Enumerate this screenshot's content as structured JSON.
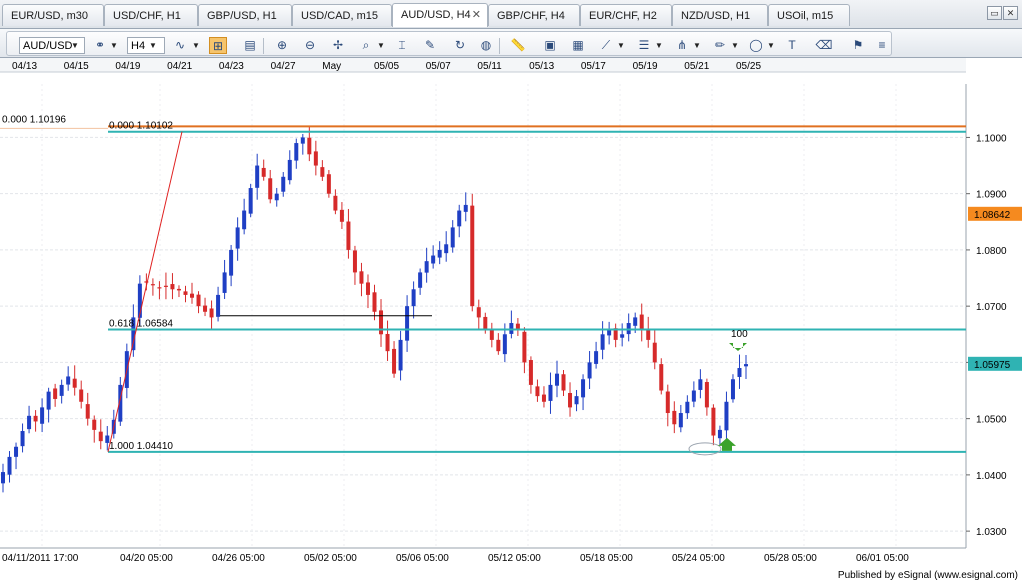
{
  "tabs": [
    {
      "label": "EUR/USD, m30",
      "active": false
    },
    {
      "label": "USD/CHF, H1",
      "active": false
    },
    {
      "label": "GBP/USD, H1",
      "active": false
    },
    {
      "label": "USD/CAD, m15",
      "active": false
    },
    {
      "label": "AUD/USD, H4",
      "active": true
    },
    {
      "label": "GBP/CHF, H4",
      "active": false
    },
    {
      "label": "EUR/CHF, H2",
      "active": false
    },
    {
      "label": "NZD/USD, H1",
      "active": false
    },
    {
      "label": "USOil, m15",
      "active": false
    }
  ],
  "tab_close_glyph": "✕",
  "toolbar": {
    "symbol": "AUD/USD",
    "interval": "H4"
  },
  "chart_data": {
    "type": "candlestick",
    "symbol": "AUD/USD",
    "interval": "H4",
    "ylim": [
      1.027,
      1.1095
    ],
    "y_ticks": [
      "1.1000",
      "1.0900",
      "1.0800",
      "1.0700",
      "1.0600",
      "1.0500",
      "1.0400",
      "1.0300"
    ],
    "top_date_labels": [
      "04/13",
      "04/15",
      "04/19",
      "04/21",
      "04/23",
      "04/27",
      "May",
      "05/05",
      "05/07",
      "05/11",
      "05/13",
      "05/17",
      "05/19",
      "05/21",
      "05/25"
    ],
    "bottom_date_labels": [
      "04/11/2011 17:00",
      "04/20 05:00",
      "04/26 05:00",
      "05/02 05:00",
      "05/06 05:00",
      "05/12 05:00",
      "05/18 05:00",
      "05/24 05:00",
      "05/28 05:00",
      "06/01 05:00"
    ],
    "current_price": "1.05975",
    "marked_price": "1.08642",
    "fib_levels": [
      {
        "label": "0.000 1.10196",
        "price": 1.10196
      },
      {
        "label": "0.000 1.10102",
        "price": 1.10102
      },
      {
        "label": "0.618 1.06584",
        "price": 1.06584
      },
      {
        "label": "1.000 1.04410",
        "price": 1.0441
      }
    ],
    "horizontal_line_price": 1.0683,
    "annotation": "100",
    "closes": [
      1.0405,
      1.0432,
      1.045,
      1.0478,
      1.0505,
      1.0495,
      1.052,
      1.0548,
      1.0535,
      1.056,
      1.0575,
      1.0555,
      1.053,
      1.05,
      1.048,
      1.046,
      1.047,
      1.0498,
      1.056,
      1.062,
      1.068,
      1.074,
      1.0742,
      1.0738,
      1.0732,
      1.0735,
      1.073,
      1.0728,
      1.072,
      1.0715,
      1.07,
      1.069,
      1.068,
      1.072,
      1.076,
      1.08,
      1.084,
      1.087,
      1.091,
      1.095,
      1.093,
      1.089,
      1.09,
      1.093,
      1.096,
      1.099,
      1.1,
      1.097,
      1.095,
      1.093,
      1.09,
      1.087,
      1.085,
      1.08,
      1.076,
      1.074,
      1.072,
      1.069,
      1.065,
      1.062,
      1.058,
      1.064,
      1.07,
      1.073,
      1.076,
      1.078,
      1.079,
      1.08,
      1.081,
      1.084,
      1.087,
      1.088,
      1.07,
      1.068,
      1.066,
      1.064,
      1.062,
      1.065,
      1.067,
      1.066,
      1.06,
      1.056,
      1.054,
      1.053,
      1.056,
      1.058,
      1.055,
      1.052,
      1.054,
      1.057,
      1.06,
      1.062,
      1.065,
      1.066,
      1.064,
      1.065,
      1.067,
      1.068,
      1.066,
      1.064,
      1.06,
      1.055,
      1.051,
      1.049,
      1.051,
      1.053,
      1.055,
      1.057,
      1.052,
      1.047,
      1.048,
      1.053,
      1.057,
      1.059,
      1.0597
    ]
  },
  "footer": "Published by eSignal (www.esignal.com)"
}
